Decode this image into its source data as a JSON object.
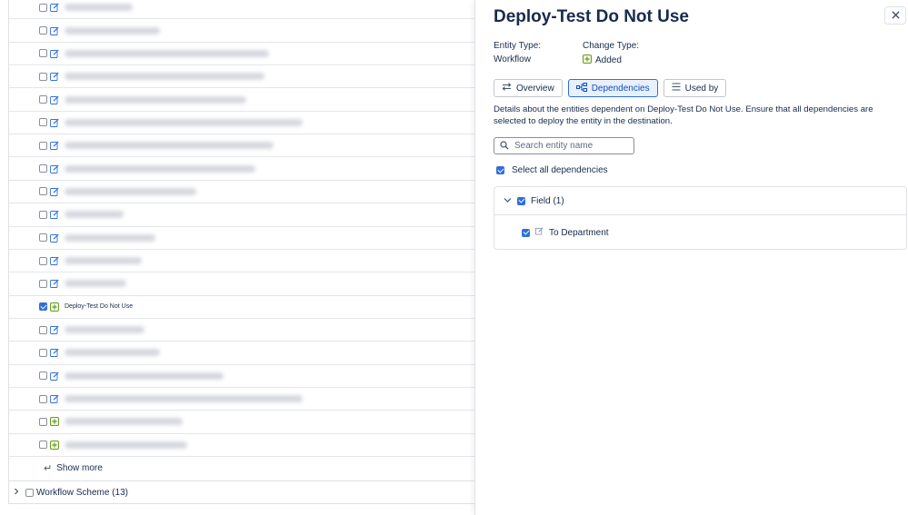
{
  "left_list": {
    "rows": [
      {
        "name": "",
        "checked": false,
        "icon": "edit-icon",
        "blur_w": 75
      },
      {
        "name": "",
        "checked": false,
        "icon": "edit-icon",
        "blur_w": 105
      },
      {
        "name": "",
        "checked": false,
        "icon": "edit-icon",
        "blur_w": 225
      },
      {
        "name": "",
        "checked": false,
        "icon": "edit-icon",
        "blur_w": 220
      },
      {
        "name": "",
        "checked": false,
        "icon": "edit-icon",
        "blur_w": 200
      },
      {
        "name": "",
        "checked": false,
        "icon": "edit-icon",
        "blur_w": 262
      },
      {
        "name": "",
        "checked": false,
        "icon": "edit-icon",
        "blur_w": 230
      },
      {
        "name": "",
        "checked": false,
        "icon": "edit-icon",
        "blur_w": 210
      },
      {
        "name": "",
        "checked": false,
        "icon": "edit-icon",
        "blur_w": 145
      },
      {
        "name": "",
        "checked": false,
        "icon": "edit-icon",
        "blur_w": 65
      },
      {
        "name": "",
        "checked": false,
        "icon": "edit-icon",
        "blur_w": 100
      },
      {
        "name": "",
        "checked": false,
        "icon": "edit-icon",
        "blur_w": 85
      },
      {
        "name": "",
        "checked": false,
        "icon": "edit-icon",
        "blur_w": 68
      },
      {
        "name": "Deploy-Test Do Not Use",
        "checked": true,
        "icon": "added-icon",
        "blur_w": 0
      },
      {
        "name": "",
        "checked": false,
        "icon": "edit-icon",
        "blur_w": 88
      },
      {
        "name": "",
        "checked": false,
        "icon": "edit-icon",
        "blur_w": 105
      },
      {
        "name": "",
        "checked": false,
        "icon": "edit-icon",
        "blur_w": 175
      },
      {
        "name": "",
        "checked": false,
        "icon": "edit-icon",
        "blur_w": 262
      },
      {
        "name": "",
        "checked": false,
        "icon": "added-icon",
        "blur_w": 130
      },
      {
        "name": "",
        "checked": false,
        "icon": "added-icon",
        "blur_w": 135
      }
    ],
    "show_more_label": "Show more",
    "show_more_icon": "return-arrow-icon",
    "scheme_label": "Workflow Scheme (13)"
  },
  "panel": {
    "title": "Deploy-Test Do Not Use",
    "entity_type_label": "Entity Type:",
    "entity_type_value": "Workflow",
    "change_type_label": "Change Type:",
    "change_type_value": "Added",
    "tabs": [
      {
        "label": "Overview",
        "icon": "swap-arrows-icon",
        "active": false
      },
      {
        "label": "Dependencies",
        "icon": "hierarchy-icon",
        "active": true
      },
      {
        "label": "Used by",
        "icon": "list-icon",
        "active": false
      }
    ],
    "description": "Details about the entities dependent on Deploy-Test Do Not Use. Ensure that all dependencies are selected to deploy the entity in the destination.",
    "search_placeholder": "Search entity name",
    "select_all_label": "Select all dependencies",
    "group_label": "Field (1)",
    "group_item_label": "To Department"
  },
  "colors": {
    "accent": "#2f6fdc",
    "added_green": "#6a9a23",
    "text": "#172b4d",
    "border": "#dfe1e6"
  }
}
